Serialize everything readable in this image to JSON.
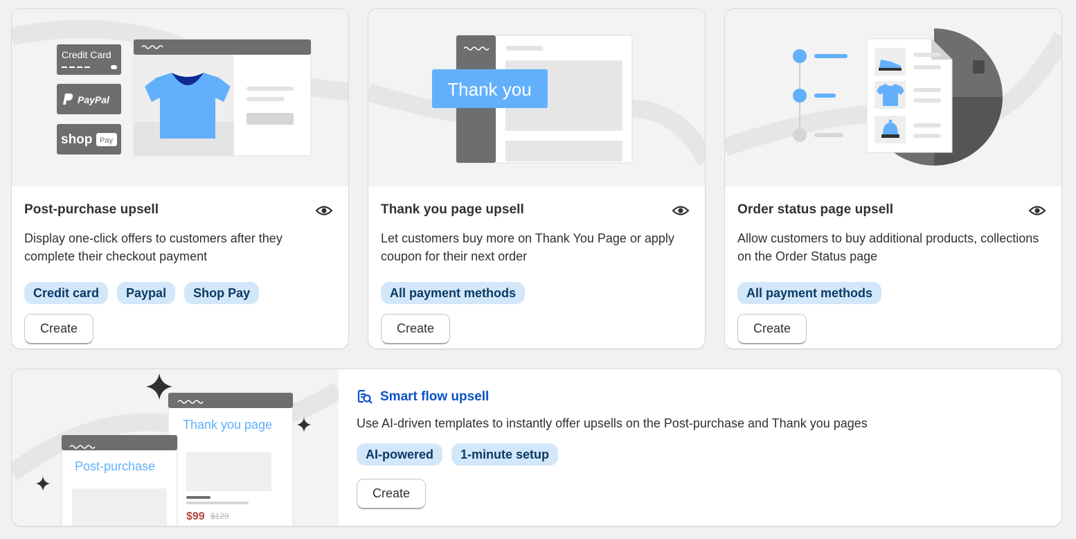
{
  "cards": [
    {
      "title": "Post-purchase upsell",
      "description": "Display one-click offers to customers after they complete their checkout payment",
      "tags": [
        "Credit card",
        "Paypal",
        "Shop Pay"
      ],
      "create_label": "Create",
      "illustration": {
        "credit_card_label": "Credit Card",
        "paypal_label": "PayPal",
        "shop_label": "shop",
        "pay_label": "Pay"
      }
    },
    {
      "title": "Thank you page upsell",
      "description": "Let customers buy more on Thank You Page or apply coupon for their next order",
      "tags": [
        "All payment methods"
      ],
      "create_label": "Create",
      "illustration": {
        "thank_you_label": "Thank you"
      }
    },
    {
      "title": "Order status page upsell",
      "description": "Allow customers to buy additional products, collections on the Order Status page",
      "tags": [
        "All payment methods"
      ],
      "create_label": "Create"
    }
  ],
  "smart_flow": {
    "title": "Smart flow upsell",
    "description": "Use AI-driven templates to instantly offer upsells on the Post-purchase and Thank you pages",
    "tags": [
      "AI-powered",
      "1-minute setup"
    ],
    "create_label": "Create",
    "illustration": {
      "thank_you_page_label": "Thank you page",
      "post_purchase_label": "Post-purchase",
      "price": "$99",
      "old_price": "$129"
    }
  },
  "colors": {
    "tag_bg": "#d3e7fb",
    "tag_text": "#0b3a64",
    "accent_blue": "#62b0fb",
    "link_blue": "#0a52c6",
    "illustration_gray": "#6e6e6e"
  }
}
